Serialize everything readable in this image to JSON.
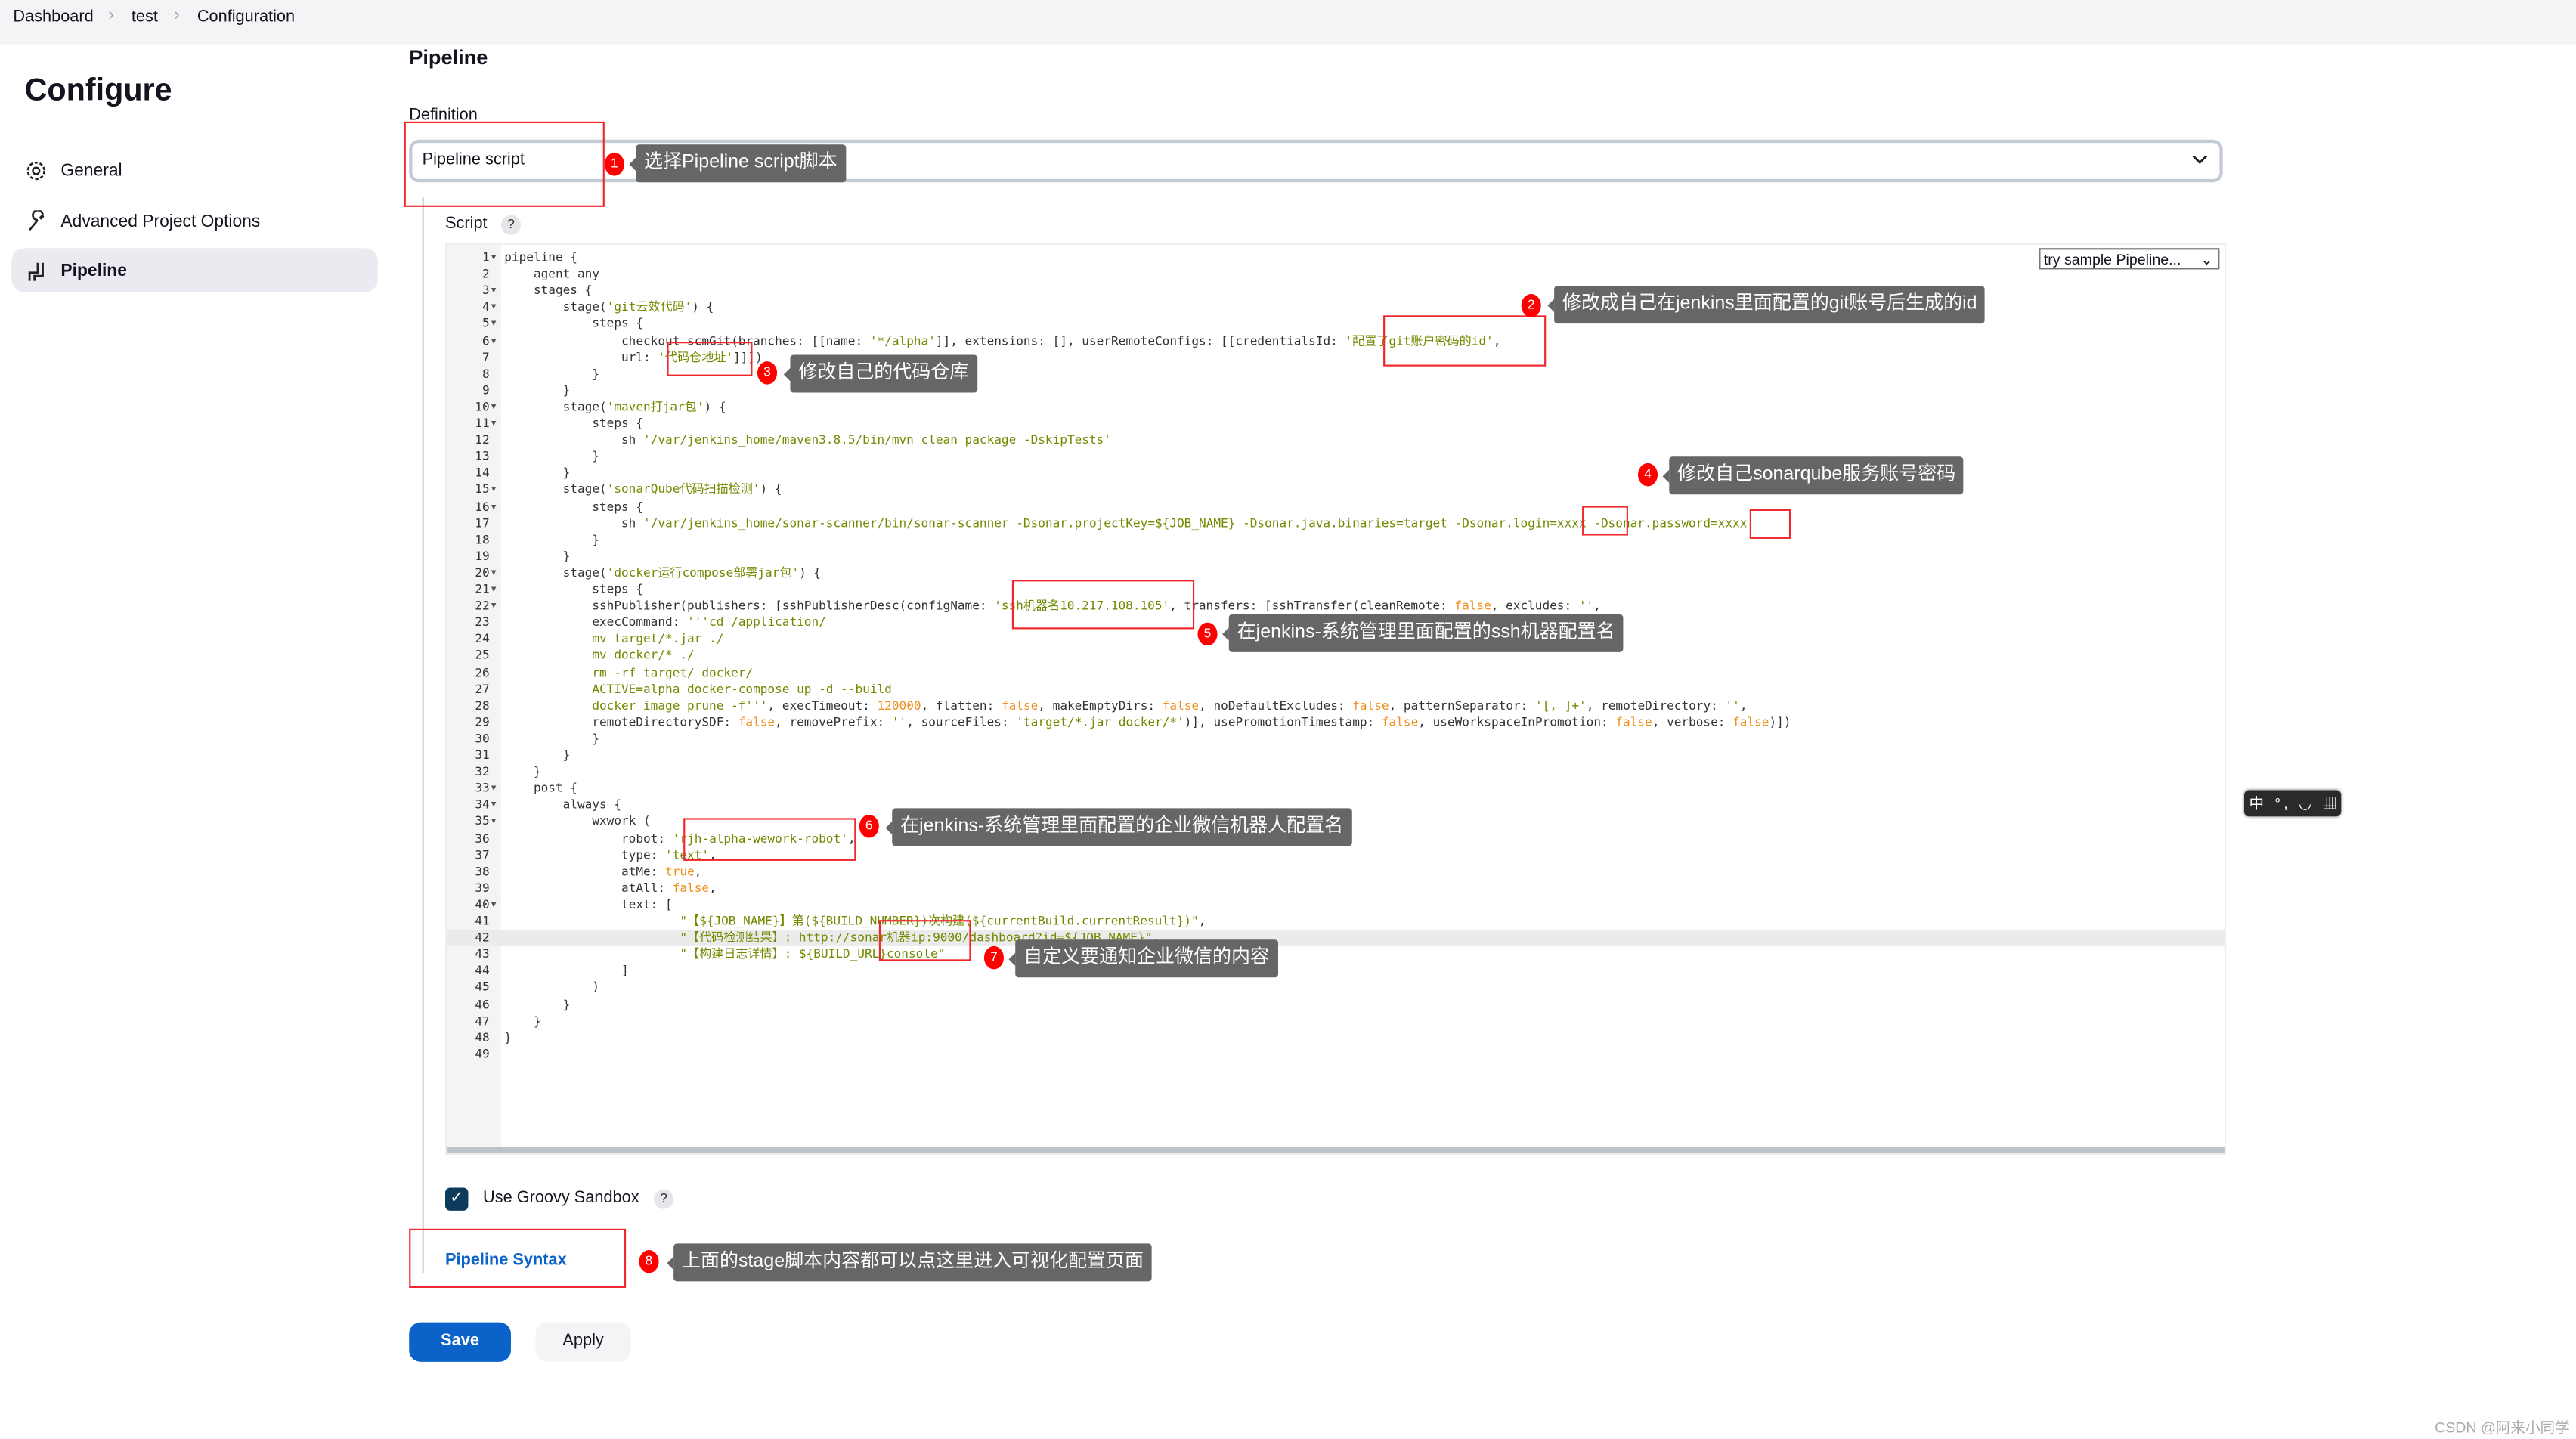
{
  "breadcrumb": [
    "Dashboard",
    "test",
    "Configuration"
  ],
  "sidebar": {
    "title": "Configure",
    "items": [
      {
        "label": "General",
        "icon": "gear-icon"
      },
      {
        "label": "Advanced Project Options",
        "icon": "wrench-icon"
      },
      {
        "label": "Pipeline",
        "icon": "pipeline-icon",
        "active": true
      }
    ]
  },
  "main": {
    "section_title": "Pipeline",
    "definition_label": "Definition",
    "definition_value": "Pipeline script",
    "script_label": "Script",
    "help": "?",
    "sample_select": "try sample Pipeline...",
    "sandbox_label": "Use Groovy Sandbox",
    "sandbox_checked": true,
    "syntax_link": "Pipeline Syntax",
    "save_label": "Save",
    "apply_label": "Apply"
  },
  "editor": {
    "highlighted_line": 42,
    "fold_lines": [
      1,
      3,
      4,
      5,
      6,
      10,
      11,
      15,
      16,
      20,
      21,
      22,
      33,
      34,
      35,
      40
    ],
    "lines": [
      [
        [
          "pipeline {",
          "p"
        ]
      ],
      [
        [
          "    agent any",
          "p"
        ]
      ],
      [
        [
          "    stages {",
          "p"
        ]
      ],
      [
        [
          "        stage(",
          "p"
        ],
        [
          "'git云效代码'",
          "s"
        ],
        [
          ") {",
          "p"
        ]
      ],
      [
        [
          "            steps {",
          "p"
        ]
      ],
      [
        [
          "                checkout scmGit(branches: [[name: ",
          "p"
        ],
        [
          "'*/alpha'",
          "s"
        ],
        [
          "]], extensions: [], userRemoteConfigs: [[credentialsId: ",
          "p"
        ],
        [
          "'配置了git账户密码的id'",
          "s"
        ],
        [
          ",",
          "p"
        ]
      ],
      [
        [
          "                url: ",
          "p"
        ],
        [
          "'代码仓地址'",
          "s"
        ],
        [
          "]]])",
          "p"
        ]
      ],
      [
        [
          "            }",
          "p"
        ]
      ],
      [
        [
          "        }",
          "p"
        ]
      ],
      [
        [
          "        stage(",
          "p"
        ],
        [
          "'maven打jar包'",
          "s"
        ],
        [
          ") {",
          "p"
        ]
      ],
      [
        [
          "            steps {",
          "p"
        ]
      ],
      [
        [
          "                sh ",
          "p"
        ],
        [
          "'/var/jenkins_home/maven3.8.5/bin/mvn clean package -DskipTests'",
          "s"
        ]
      ],
      [
        [
          "            }",
          "p"
        ]
      ],
      [
        [
          "        }",
          "p"
        ]
      ],
      [
        [
          "        stage(",
          "p"
        ],
        [
          "'sonarQube代码扫描检测'",
          "s"
        ],
        [
          ") {",
          "p"
        ]
      ],
      [
        [
          "            steps {",
          "p"
        ]
      ],
      [
        [
          "                sh ",
          "p"
        ],
        [
          "'/var/jenkins_home/sonar-scanner/bin/sonar-scanner -Dsonar.projectKey=${JOB_NAME} -Dsonar.java.binaries=target -Dsonar.login=xxxx -Dsonar.password=xxxx'",
          "s"
        ]
      ],
      [
        [
          "            }",
          "p"
        ]
      ],
      [
        [
          "        }",
          "p"
        ]
      ],
      [
        [
          "        stage(",
          "p"
        ],
        [
          "'docker运行compose部署jar包'",
          "s"
        ],
        [
          ") {",
          "p"
        ]
      ],
      [
        [
          "            steps {",
          "p"
        ]
      ],
      [
        [
          "            sshPublisher(publishers: [sshPublisherDesc(configName: ",
          "p"
        ],
        [
          "'ssh机器名10.217.108.105'",
          "s"
        ],
        [
          ", transfers: [sshTransfer(cleanRemote: ",
          "p"
        ],
        [
          "false",
          "k"
        ],
        [
          ", excludes: ",
          "p"
        ],
        [
          "''",
          "s"
        ],
        [
          ",",
          "p"
        ]
      ],
      [
        [
          "            execCommand: ",
          "p"
        ],
        [
          "'''cd /application/",
          "s"
        ]
      ],
      [
        [
          "            mv target/*.jar ./",
          "s"
        ]
      ],
      [
        [
          "            mv docker/* ./",
          "s"
        ]
      ],
      [
        [
          "            rm -rf target/ docker/",
          "s"
        ]
      ],
      [
        [
          "            ACTIVE=alpha docker-compose up -d --build",
          "s"
        ]
      ],
      [
        [
          "            docker image prune -f'''",
          "s"
        ],
        [
          ", execTimeout: ",
          "p"
        ],
        [
          "120000",
          "k"
        ],
        [
          ", flatten: ",
          "p"
        ],
        [
          "false",
          "k"
        ],
        [
          ", makeEmptyDirs: ",
          "p"
        ],
        [
          "false",
          "k"
        ],
        [
          ", noDefaultExcludes: ",
          "p"
        ],
        [
          "false",
          "k"
        ],
        [
          ", patternSeparator: ",
          "p"
        ],
        [
          "'[, ]+'",
          "s"
        ],
        [
          ", remoteDirectory: ",
          "p"
        ],
        [
          "''",
          "s"
        ],
        [
          ",",
          "p"
        ]
      ],
      [
        [
          "            remoteDirectorySDF: ",
          "p"
        ],
        [
          "false",
          "k"
        ],
        [
          ", removePrefix: ",
          "p"
        ],
        [
          "''",
          "s"
        ],
        [
          ", sourceFiles: ",
          "p"
        ],
        [
          "'target/*.jar docker/*'",
          "s"
        ],
        [
          ")], usePromotionTimestamp: ",
          "p"
        ],
        [
          "false",
          "k"
        ],
        [
          ", useWorkspaceInPromotion: ",
          "p"
        ],
        [
          "false",
          "k"
        ],
        [
          ", verbose: ",
          "p"
        ],
        [
          "false",
          "k"
        ],
        [
          ")])",
          "p"
        ]
      ],
      [
        [
          "            }",
          "p"
        ]
      ],
      [
        [
          "        }",
          "p"
        ]
      ],
      [
        [
          "    }",
          "p"
        ]
      ],
      [
        [
          "    post {",
          "p"
        ]
      ],
      [
        [
          "        always {",
          "p"
        ]
      ],
      [
        [
          "            wxwork (",
          "p"
        ]
      ],
      [
        [
          "                robot: ",
          "p"
        ],
        [
          "'rjh-alpha-wework-robot'",
          "s"
        ],
        [
          ",",
          "p"
        ]
      ],
      [
        [
          "                type: ",
          "p"
        ],
        [
          "'text'",
          "s"
        ],
        [
          ",",
          "p"
        ]
      ],
      [
        [
          "                atMe: ",
          "p"
        ],
        [
          "true",
          "k"
        ],
        [
          ",",
          "p"
        ]
      ],
      [
        [
          "                atAll: ",
          "p"
        ],
        [
          "false",
          "k"
        ],
        [
          ",",
          "p"
        ]
      ],
      [
        [
          "                text: [",
          "p"
        ]
      ],
      [
        [
          "                        ",
          "p"
        ],
        [
          "\"【${JOB_NAME}】第(${BUILD_NUMBER})次构建(${currentBuild.currentResult})\"",
          "s"
        ],
        [
          ",",
          "p"
        ]
      ],
      [
        [
          "                        ",
          "p"
        ],
        [
          "\"【代码检测结果】: http://sonar机器ip:9000/dashboard?id=${JOB_NAME}\"",
          "s"
        ],
        [
          ",",
          "p"
        ]
      ],
      [
        [
          "                        ",
          "p"
        ],
        [
          "\"【构建日志详情】: ${BUILD_URL}console\"",
          "s"
        ]
      ],
      [
        [
          "                ]",
          "p"
        ]
      ],
      [
        [
          "            )",
          "p"
        ]
      ],
      [
        [
          "        }",
          "p"
        ]
      ],
      [
        [
          "    }",
          "p"
        ]
      ],
      [
        [
          "}",
          "p"
        ]
      ],
      []
    ]
  },
  "annotations": [
    {
      "num": "1",
      "text": "选择Pipeline script脚本"
    },
    {
      "num": "2",
      "text": "修改成自己在jenkins里面配置的git账号后生成的id"
    },
    {
      "num": "3",
      "text": "修改自己的代码仓库"
    },
    {
      "num": "4",
      "text": "修改自己sonarqube服务账号密码"
    },
    {
      "num": "5",
      "text": "在jenkins-系统管理里面配置的ssh机器配置名"
    },
    {
      "num": "6",
      "text": "在jenkins-系统管理里面配置的企业微信机器人配置名"
    },
    {
      "num": "7",
      "text": "自定义要通知企业微信的内容"
    },
    {
      "num": "8",
      "text": "上面的stage脚本内容都可以点这里进入可视化配置页面"
    }
  ],
  "ime_toolbar": "中 °, ◡ ▦ S",
  "watermark": "CSDN @阿来小同学",
  "colors": {
    "primary": "#0b62c9",
    "annotation_red": "#f0282d",
    "string": "#6f8b00",
    "keyword": "#f0901e"
  }
}
